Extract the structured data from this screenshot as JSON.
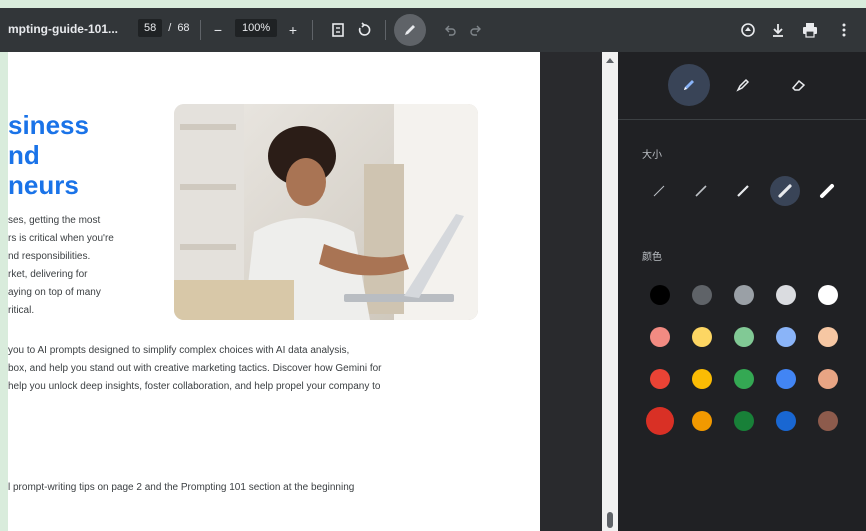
{
  "toolbar": {
    "title": "mpting-guide-101...",
    "page_current": "58",
    "page_sep": "/",
    "page_total": "68",
    "zoom_minus": "−",
    "zoom": "100%",
    "zoom_plus": "+",
    "undo_icon": "undo-icon",
    "redo_icon": "redo-icon"
  },
  "document": {
    "title_lines": [
      "siness",
      "nd",
      "neurs"
    ],
    "para1": [
      "ses, getting the most",
      "rs is critical when you're",
      "nd responsibilities.",
      "rket, delivering for",
      "aying on top of many",
      "ritical."
    ],
    "para2": [
      "you to AI prompts designed to simplify complex choices with AI data analysis,",
      "box, and help you stand out with creative marketing tactics. Discover how Gemini for",
      "help you unlock deep insights, foster collaboration, and help propel your company to"
    ],
    "para3": "l prompt-writing tips on page 2 and the Prompting 101 section at the beginning"
  },
  "panel": {
    "size_label": "大小",
    "color_label": "颜色",
    "tools": [
      "pen-tool",
      "highlighter-tool",
      "eraser-tool"
    ],
    "active_tool": 0,
    "active_size": 3,
    "colors": [
      [
        "#000000",
        "#5f6368",
        "#9aa0a6",
        "#dadce0",
        "#ffffff"
      ],
      [
        "#f28b82",
        "#fdd663",
        "#81c995",
        "#8ab4f8",
        "#f6c7a3"
      ],
      [
        "#ea4335",
        "#fbbc04",
        "#34a853",
        "#4285f4",
        "#e8a584"
      ],
      [
        "#d93025",
        "#f29900",
        "#188038",
        "#1967d2",
        "#8d5b4c"
      ]
    ],
    "selected_color": "#d93025"
  }
}
